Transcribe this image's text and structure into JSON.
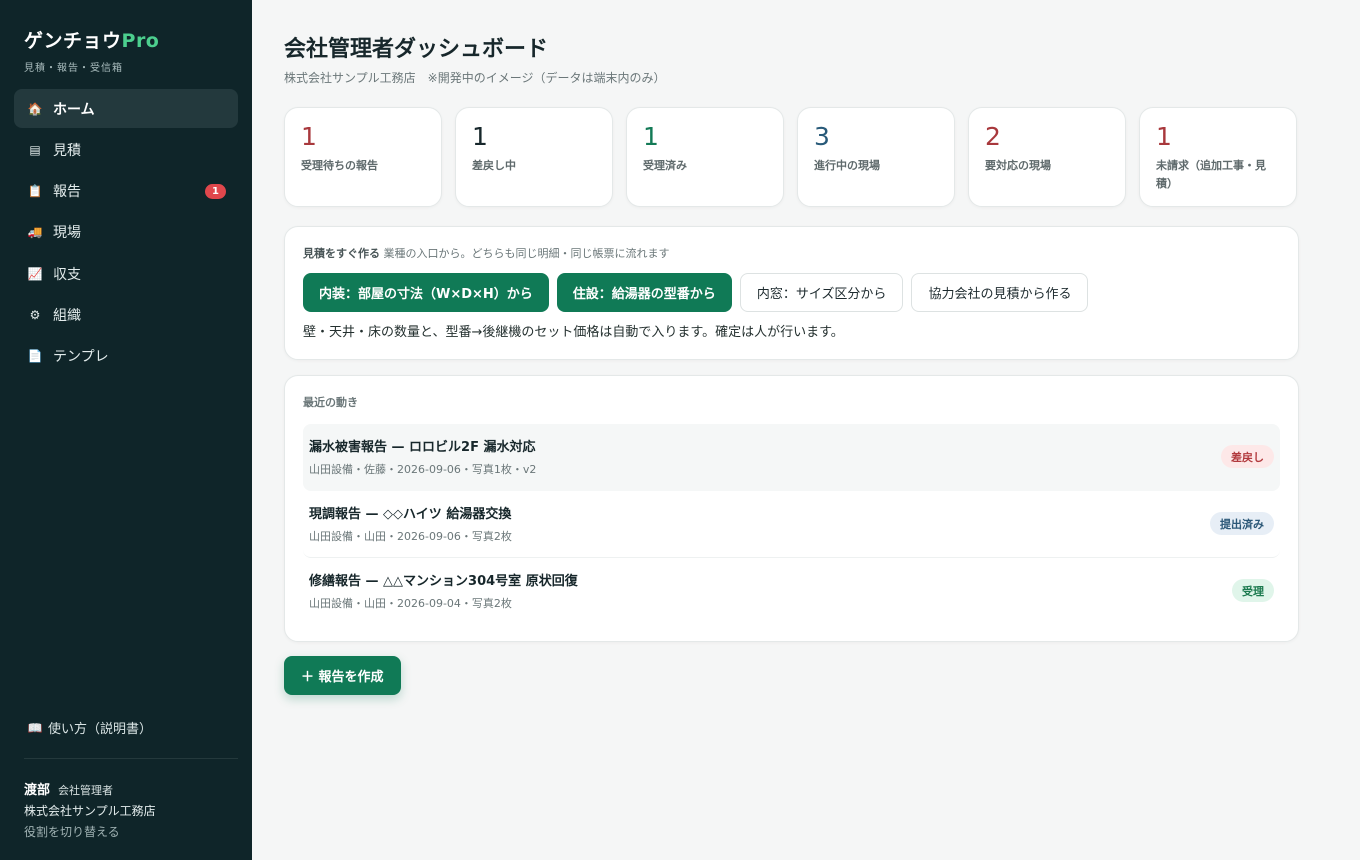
{
  "brand": {
    "name": "ゲンチョウ",
    "suffix": "Pro",
    "tagline": "見積・報告・受信箱"
  },
  "sidebar": {
    "items": [
      {
        "label": "ホーム",
        "icon": "home-icon",
        "glyph": "🏠"
      },
      {
        "label": "見積",
        "icon": "document-stack-icon",
        "glyph": "▤"
      },
      {
        "label": "報告",
        "icon": "clipboard-icon",
        "glyph": "📋",
        "badge": "1"
      },
      {
        "label": "現場",
        "icon": "truck-icon",
        "glyph": "🚚"
      },
      {
        "label": "収支",
        "icon": "chart-icon",
        "glyph": "📈"
      },
      {
        "label": "組織",
        "icon": "gear-icon",
        "glyph": "⚙"
      },
      {
        "label": "テンプレ",
        "icon": "page-icon",
        "glyph": "📄"
      }
    ],
    "help": {
      "label": "使い方（説明書）",
      "icon": "book-icon",
      "glyph": "📖"
    },
    "user": {
      "name": "渡部",
      "role": "会社管理者",
      "company": "株式会社サンプル工務店",
      "switch": "役割を切り替える"
    }
  },
  "header": {
    "title": "会社管理者ダッシュボード",
    "subtitle": "株式会社サンプル工務店　※開発中のイメージ（データは端末内のみ）"
  },
  "stats": [
    {
      "value": "1",
      "label": "受理待ちの報告",
      "color": "#a8383c"
    },
    {
      "value": "1",
      "label": "差戻し中",
      "color": "#17272b"
    },
    {
      "value": "1",
      "label": "受理済み",
      "color": "#137a56"
    },
    {
      "value": "3",
      "label": "進行中の現場",
      "color": "#285a79"
    },
    {
      "value": "2",
      "label": "要対応の現場",
      "color": "#a8383c"
    },
    {
      "value": "1",
      "label": "未請求（追加工事・見積）",
      "color": "#a8383c"
    }
  ],
  "quick": {
    "heading": "見積をすぐ作る",
    "heading_note": "業種の入口から。どちらも同じ明細・同じ帳票に流れます",
    "buttons": [
      {
        "label": "内装：部屋の寸法（W×D×H）から",
        "style": "primary"
      },
      {
        "label": "住設：給湯器の型番から",
        "style": "primary"
      },
      {
        "label": "内窓：サイズ区分から",
        "style": "outline"
      },
      {
        "label": "協力会社の見積から作る",
        "style": "outline"
      }
    ],
    "note": "壁・天井・床の数量と、型番→後継機のセット価格は自動で入ります。確定は人が行います。"
  },
  "recent": {
    "heading": "最近の動き",
    "items": [
      {
        "title": "漏水被害報告 — ロロビル2F 漏水対応",
        "meta": "山田設備・佐藤・2026-09-06・写真1枚・v2",
        "status": "差戻し",
        "status_type": "returned"
      },
      {
        "title": "現調報告 — ◇◇ハイツ 給湯器交換",
        "meta": "山田設備・山田・2026-09-06・写真2枚",
        "status": "提出済み",
        "status_type": "submitted"
      },
      {
        "title": "修繕報告 — △△マンション304号室 原状回復",
        "meta": "山田設備・山田・2026-09-04・写真2枚",
        "status": "受理",
        "status_type": "accepted"
      }
    ]
  },
  "actions": {
    "create_report": "＋ 報告を作成"
  }
}
